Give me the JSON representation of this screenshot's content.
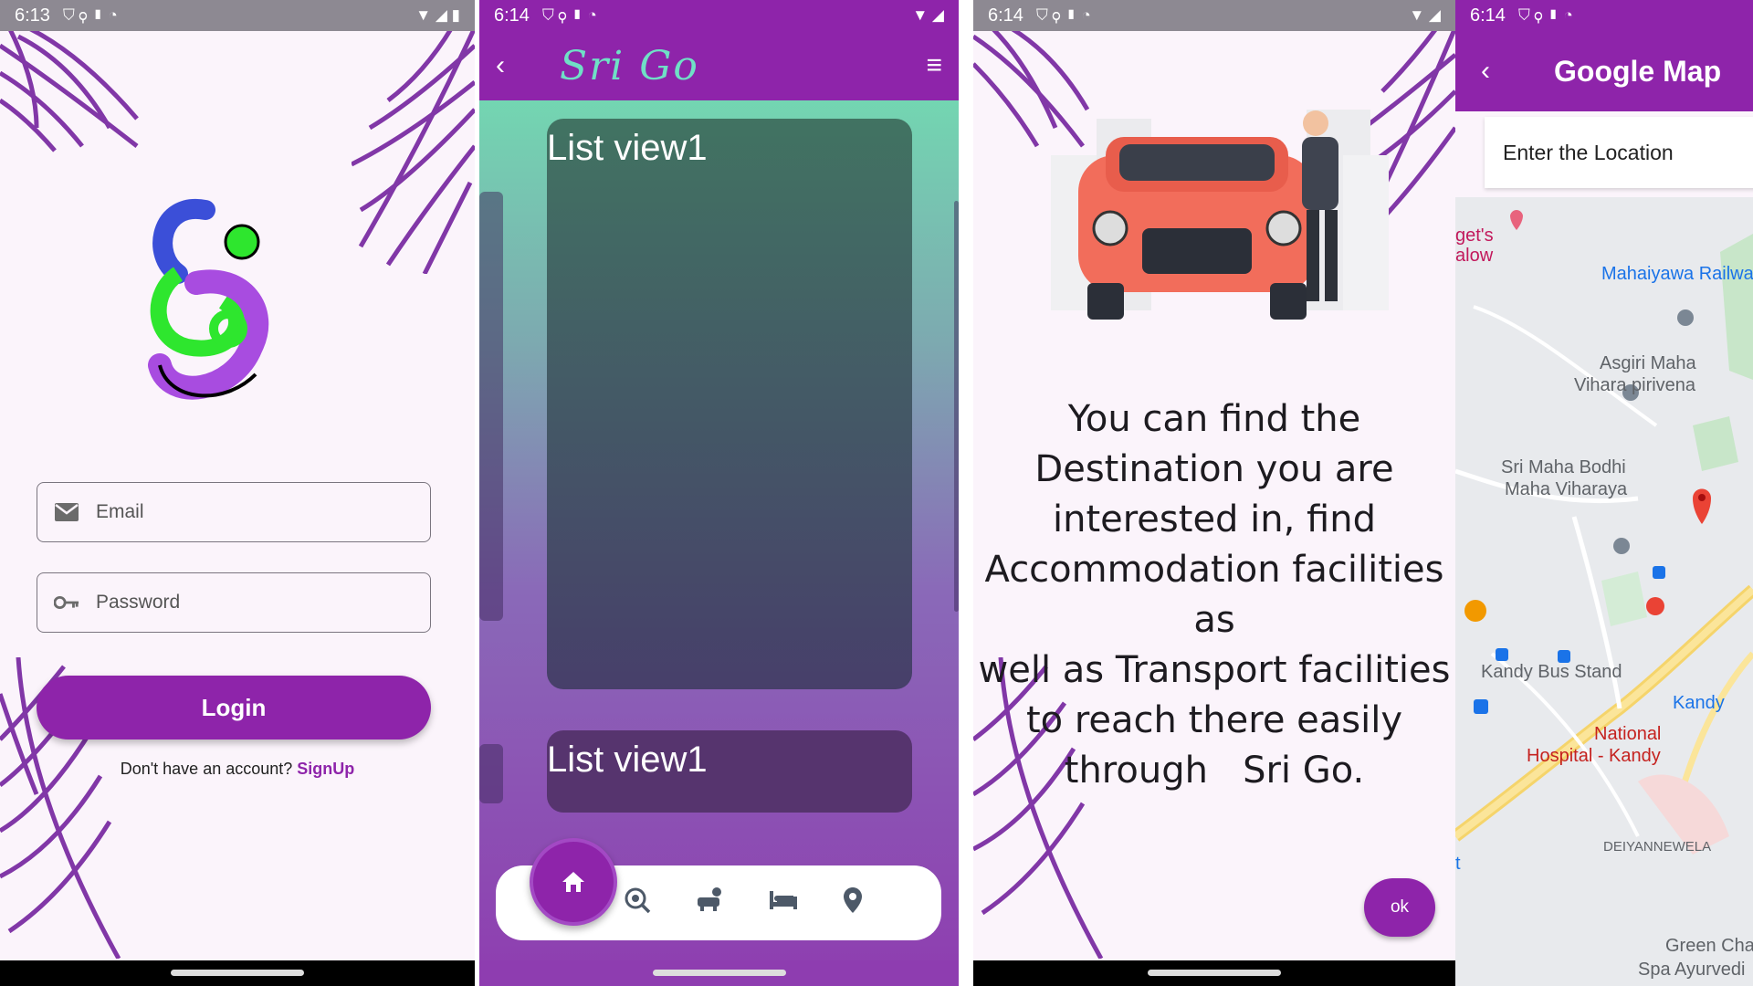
{
  "colors": {
    "primary": "#8e24aa",
    "accent_teal": "#6fe0c6",
    "background": "#fbf4fb"
  },
  "screen1": {
    "status": {
      "time": "6:13"
    },
    "email_placeholder": "Email",
    "password_placeholder": "Password",
    "login_label": "Login",
    "signup_prompt": "Don't have an account?",
    "signup_link": "SignUp"
  },
  "screen2": {
    "status": {
      "time": "6:14"
    },
    "brand": "Sri Go",
    "cards": [
      {
        "title": "List view1"
      },
      {
        "title": "List view1"
      }
    ],
    "nav_icons": [
      "home-icon",
      "travel-explore-icon",
      "car-repair-icon",
      "hotel-bed-icon",
      "location-pin-icon"
    ]
  },
  "screen3": {
    "status": {
      "time": "6:14"
    },
    "info_lines": [
      "You can find the",
      "Destination you are",
      "interested in, find",
      "Accommodation facilities as",
      "well as Transport facilities",
      "to reach there easily",
      "through   Sri Go."
    ],
    "ok_label": "ok"
  },
  "screen4": {
    "status": {
      "time": "6:14"
    },
    "title": "Google Map",
    "location_placeholder": "Enter the Location",
    "places": {
      "gets_1": "get's",
      "gets_2": "alow",
      "railway": "Mahaiyawa Railwa",
      "asgiri_1": "Asgiri Maha",
      "asgiri_2": "Vihara pirivena",
      "bodhi_1": "Sri Maha Bodhi",
      "bodhi_2": "Maha Viharaya",
      "bus_stand": "Kandy Bus Stand",
      "kandy": "Kandy",
      "hospital_1": "National",
      "hospital_2": "Hospital - Kandy",
      "deiyannewela": "DEIYANNEWELA",
      "green_1": "Green Cha",
      "green_2": "Spa Ayurvedi",
      "edge_t": "t"
    }
  }
}
